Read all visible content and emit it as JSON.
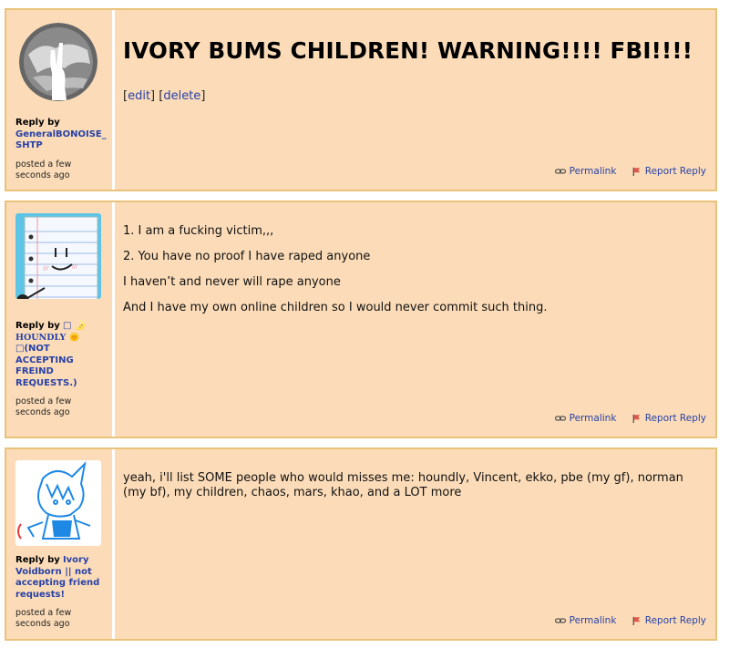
{
  "posts": [
    {
      "reply_by_label": "Reply by",
      "author": "GeneralBONOISE_SHTP",
      "posted": "posted a few seconds ago",
      "title": "IVORY BUMS CHILDREN! WARNING!!!! FBI!!!!",
      "edit_label": "edit",
      "delete_label": "delete",
      "paragraphs": [],
      "permalink_label": "Permalink",
      "report_label": "Report Reply",
      "avatar_icon": "ghost-peace-sign-avatar"
    },
    {
      "reply_by_label": "Reply by",
      "author_line1": "□ 🌛",
      "author_line2": "HOUNDLY 🌞",
      "author_line3": "□(NOT ACCEPTING FREIND REQUESTS.)",
      "posted": "posted a few seconds ago",
      "paragraphs": [
        "1. I am a fucking victim,,,",
        "2. You have no proof I have raped anyone",
        "I haven’t and never will rape anyone",
        "And I have my own online children so I would never commit such thing."
      ],
      "permalink_label": "Permalink",
      "report_label": "Report Reply",
      "avatar_icon": "notebook-paper-character-avatar"
    },
    {
      "reply_by_label": "Reply by",
      "author": "Ivory Voidborn || not accepting friend requests!",
      "posted": "posted a few seconds ago",
      "paragraphs": [
        "yeah, i'll list SOME people who would misses me: houndly, Vincent, ekko, pbe (my gf), norman (my bf), my children, chaos, mars, khao, and a LOT more"
      ],
      "permalink_label": "Permalink",
      "report_label": "Report Reply",
      "avatar_icon": "blue-sketch-character-avatar"
    }
  ],
  "colors": {
    "post_bg": "#fcdcb8",
    "post_border": "#e9c27a",
    "link": "#2741a8"
  }
}
